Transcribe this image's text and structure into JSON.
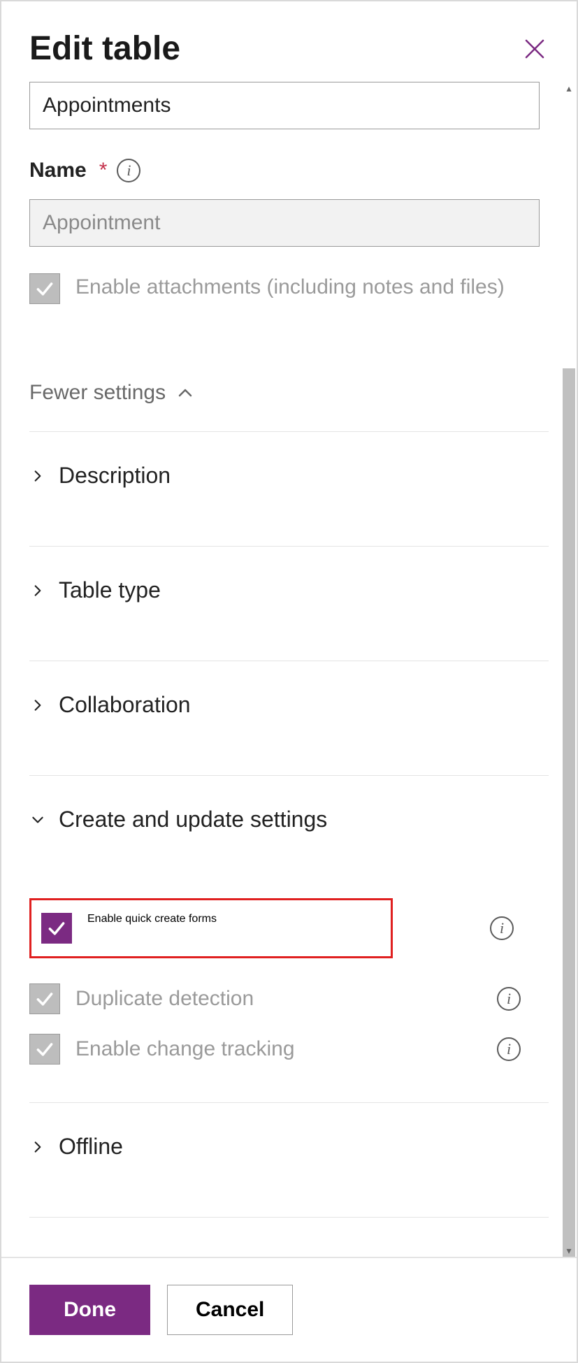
{
  "header": {
    "title": "Edit table"
  },
  "fields": {
    "displayName": {
      "value": "Appointments"
    },
    "name": {
      "label": "Name",
      "required": "*",
      "value": "Appointment"
    }
  },
  "attachments": {
    "label": "Enable attachments (including notes and files)"
  },
  "fewerSettings": {
    "label": "Fewer settings"
  },
  "sections": {
    "description": {
      "label": "Description"
    },
    "tableType": {
      "label": "Table type"
    },
    "collaboration": {
      "label": "Collaboration"
    },
    "createUpdate": {
      "label": "Create and update settings"
    },
    "offline": {
      "label": "Offline"
    }
  },
  "options": {
    "quickCreate": {
      "label": "Enable quick create forms"
    },
    "duplicate": {
      "label": "Duplicate detection"
    },
    "changeTracking": {
      "label": "Enable change tracking"
    }
  },
  "footer": {
    "done": "Done",
    "cancel": "Cancel"
  }
}
